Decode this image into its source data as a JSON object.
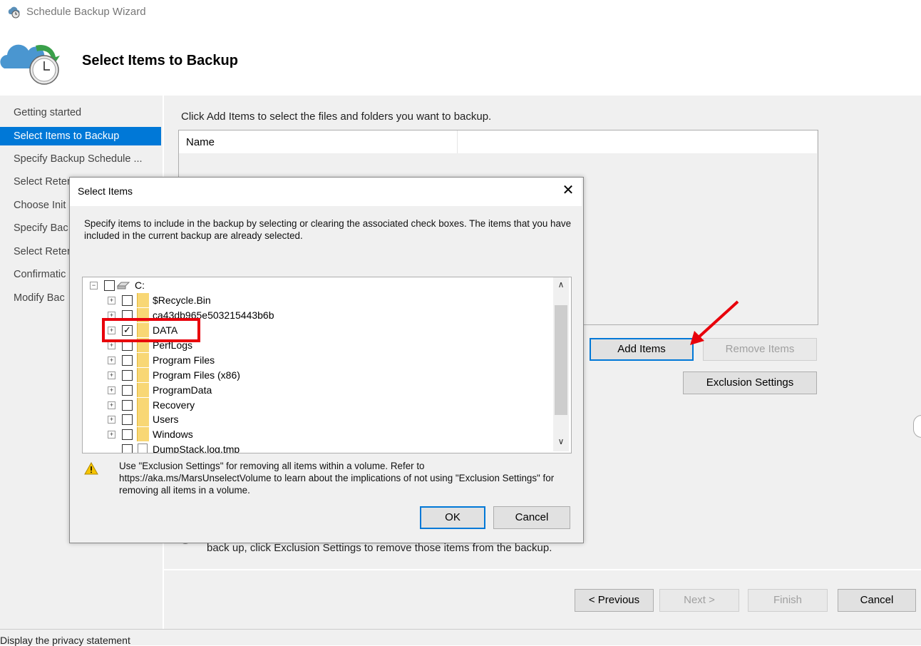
{
  "window": {
    "title": "Schedule Backup Wizard"
  },
  "header": {
    "title": "Select Items to Backup"
  },
  "nav": {
    "items": [
      {
        "label": "Getting started",
        "active": false
      },
      {
        "label": "Select Items to Backup",
        "active": true
      },
      {
        "label": "Specify Backup Schedule ...",
        "active": false
      },
      {
        "label": "Select Reter",
        "active": false
      },
      {
        "label": "Choose Init",
        "active": false
      },
      {
        "label": "Specify Bac",
        "active": false
      },
      {
        "label": "Select Reter",
        "active": false
      },
      {
        "label": "Confirmatic",
        "active": false
      },
      {
        "label": "Modify Bac",
        "active": false
      }
    ]
  },
  "main": {
    "instruction": "Click Add Items to select the files and folders you want to backup.",
    "list_header": {
      "name": "Name"
    },
    "add_items_label": "Add Items",
    "remove_items_label": "Remove Items",
    "exclusion_settings_label": "Exclusion Settings",
    "hint": "back up, click Exclusion Settings to remove those items from the backup."
  },
  "footer": {
    "previous_label": "< Previous",
    "next_label": "Next >",
    "finish_label": "Finish",
    "cancel_label": "Cancel"
  },
  "status": {
    "text": "Display the privacy statement"
  },
  "dialog": {
    "title": "Select Items",
    "close_glyph": "✕",
    "description": "Specify items to include in the backup by selecting or clearing the associated check boxes. The items that you have included in the current backup are already selected.",
    "tree": {
      "root": {
        "label": "C:",
        "checked": false
      },
      "items": [
        {
          "label": "$Recycle.Bin",
          "checked": false,
          "type": "folder"
        },
        {
          "label": "ca43db965e503215443b6b",
          "checked": false,
          "type": "folder"
        },
        {
          "label": "DATA",
          "checked": true,
          "type": "folder"
        },
        {
          "label": "PerfLogs",
          "checked": false,
          "type": "folder"
        },
        {
          "label": "Program Files",
          "checked": false,
          "type": "folder"
        },
        {
          "label": "Program Files (x86)",
          "checked": false,
          "type": "folder"
        },
        {
          "label": "ProgramData",
          "checked": false,
          "type": "folder"
        },
        {
          "label": "Recovery",
          "checked": false,
          "type": "folder"
        },
        {
          "label": "Users",
          "checked": false,
          "type": "folder"
        },
        {
          "label": "Windows",
          "checked": false,
          "type": "folder"
        },
        {
          "label": "DumpStack.log.tmp",
          "checked": false,
          "type": "file"
        }
      ]
    },
    "warning": "Use \"Exclusion Settings\" for removing all items within a volume. Refer to https://aka.ms/MarsUnselectVolume to learn about the implications of not using \"Exclusion Settings\" for removing all items in a volume.",
    "ok_label": "OK",
    "cancel_label": "Cancel"
  },
  "colors": {
    "accent": "#0078d7",
    "highlight": "#e8000b",
    "folder": "#f8d775"
  }
}
